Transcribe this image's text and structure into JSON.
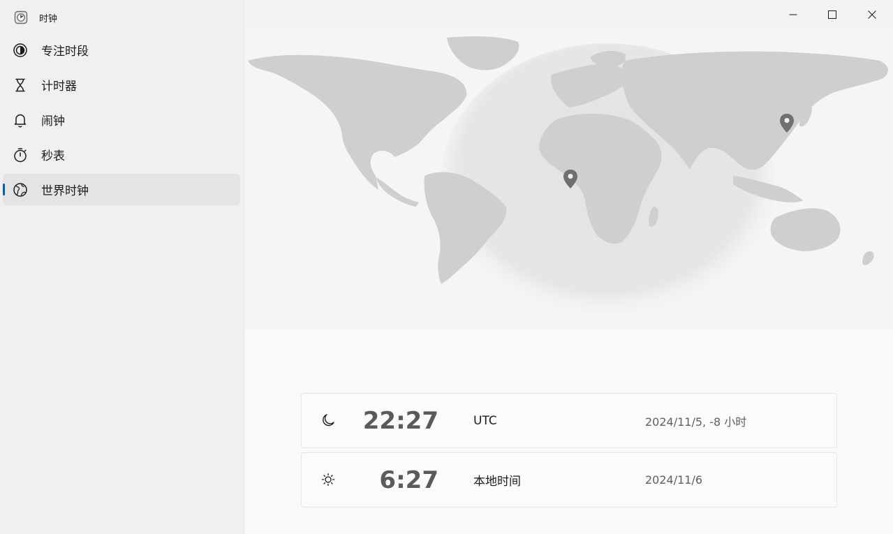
{
  "app": {
    "title": "时钟",
    "icon": "clock-app-icon"
  },
  "sidebar": {
    "items": [
      {
        "label": "专注时段",
        "icon": "focus-icon",
        "active": false
      },
      {
        "label": "计时器",
        "icon": "hourglass-icon",
        "active": false
      },
      {
        "label": "闹钟",
        "icon": "bell-icon",
        "active": false
      },
      {
        "label": "秒表",
        "icon": "stopwatch-icon",
        "active": false
      },
      {
        "label": "世界时钟",
        "icon": "globe-icon",
        "active": true
      }
    ]
  },
  "window_controls": [
    "minimize",
    "maximize",
    "close"
  ],
  "clocks": [
    {
      "time": "22:27",
      "name": "UTC",
      "date": "2024/11/5, -8 小时",
      "icon": "moon-icon"
    },
    {
      "time": "6:27",
      "name": "本地时间",
      "date": "2024/11/6",
      "icon": "sun-icon"
    }
  ],
  "colors": {
    "accent": "#005fb8",
    "sidebar_bg": "#f0f0f0",
    "map_land": "#cfcfcf",
    "pin": "#707070"
  }
}
